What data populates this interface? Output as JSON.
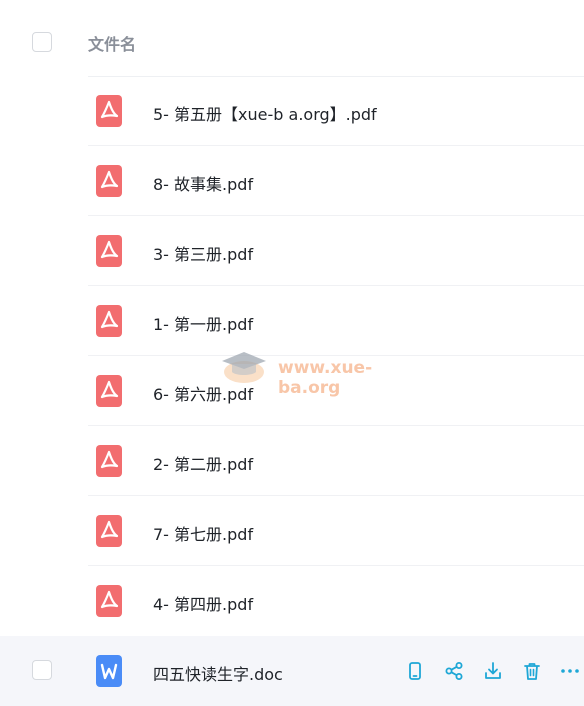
{
  "header": {
    "column_label": "文件名"
  },
  "files": [
    {
      "name": "5- 第五册【xue-b a.org】.pdf",
      "type": "pdf"
    },
    {
      "name": "8- 故事集.pdf",
      "type": "pdf"
    },
    {
      "name": "3- 第三册.pdf",
      "type": "pdf"
    },
    {
      "name": "1- 第一册.pdf",
      "type": "pdf"
    },
    {
      "name": "6- 第六册.pdf",
      "type": "pdf"
    },
    {
      "name": "2- 第二册.pdf",
      "type": "pdf"
    },
    {
      "name": "7- 第七册.pdf",
      "type": "pdf"
    },
    {
      "name": "4- 第四册.pdf",
      "type": "pdf"
    },
    {
      "name": "四五快读生字.doc",
      "type": "doc"
    }
  ],
  "row_actions": [
    "phone-icon",
    "share-icon",
    "download-icon",
    "delete-icon",
    "more-icon"
  ],
  "watermark": {
    "text": "www.xue-ba.org"
  },
  "colors": {
    "pdf_icon": "#f26d6f",
    "doc_icon": "#4a8cf7",
    "action_accent": "#1ea7d6",
    "header_text": "#8a8f99",
    "hover_row": "#f5f6fa"
  }
}
